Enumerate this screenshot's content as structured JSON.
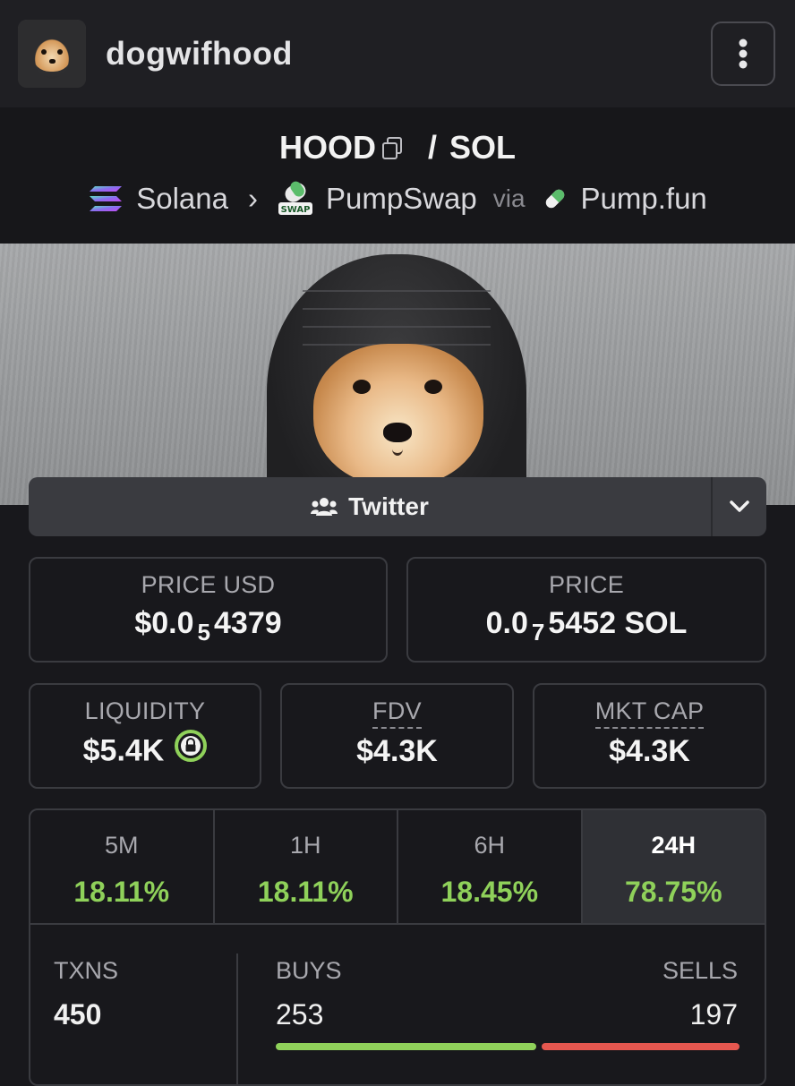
{
  "header": {
    "title": "dogwifhood",
    "menu_icon": "kebab-menu-icon"
  },
  "pair": {
    "base": "HOOD",
    "separator": "/",
    "quote": "SOL",
    "chain": "Solana",
    "dex": "PumpSwap",
    "dex_badge": "SWAP",
    "via_label": "via",
    "launchpad": "Pump.fun"
  },
  "socials": {
    "label": "Twitter",
    "icon": "users-icon",
    "dropdown_icon": "chevron-down-icon"
  },
  "price_usd": {
    "label": "PRICE USD",
    "prefix": "$0.0",
    "zeros": "5",
    "digits": "4379"
  },
  "price_native": {
    "label": "PRICE",
    "prefix": "0.0",
    "zeros": "7",
    "digits": "5452 SOL"
  },
  "liquidity": {
    "label": "LIQUIDITY",
    "value": "$5.4K",
    "icon": "lock-icon"
  },
  "fdv": {
    "label": "FDV",
    "value": "$4.3K"
  },
  "mkt_cap": {
    "label": "MKT CAP",
    "value": "$4.3K"
  },
  "timeframes": [
    {
      "label": "5M",
      "change": "18.11%"
    },
    {
      "label": "1H",
      "change": "18.11%"
    },
    {
      "label": "6H",
      "change": "18.45%"
    },
    {
      "label": "24H",
      "change": "78.75%"
    }
  ],
  "active_timeframe": "24H",
  "txns": {
    "label": "TXNS",
    "total": "450",
    "buys_label": "BUYS",
    "buys": "253",
    "sells_label": "SELLS",
    "sells": "197",
    "buy_fraction": 0.562
  },
  "colors": {
    "positive": "#8fd15a",
    "negative": "#e5574f",
    "background": "#18181c"
  }
}
